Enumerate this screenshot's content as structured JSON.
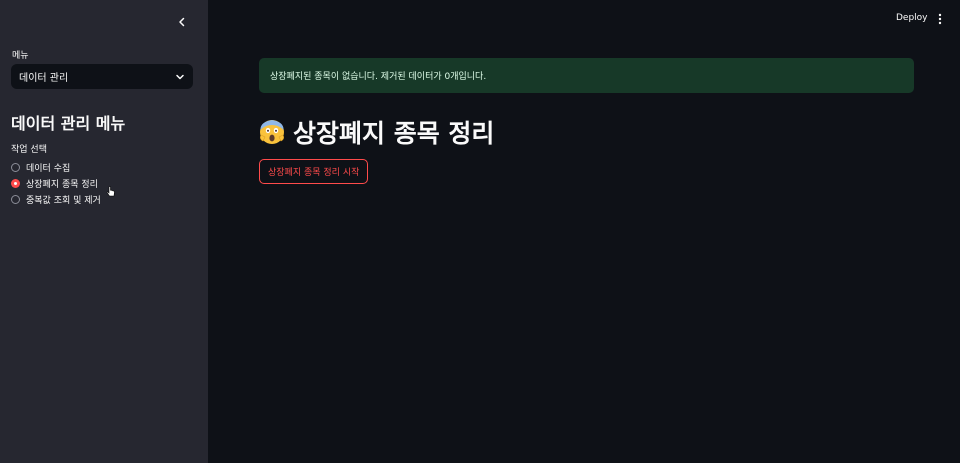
{
  "sidebar": {
    "menu_label": "메뉴",
    "menu_select_value": "데이터 관리",
    "heading": "데이터 관리 메뉴",
    "radio_label": "작업 선택",
    "radio_options": [
      {
        "label": "데이터 수집",
        "checked": false
      },
      {
        "label": "상장폐지 종목 정리",
        "checked": true
      },
      {
        "label": "중복값 조회 및 제거",
        "checked": false
      }
    ]
  },
  "header": {
    "deploy_label": "Deploy"
  },
  "main": {
    "alert_text": "상장폐지된 종목이 없습니다. 제거된 데이터가 0개입니다.",
    "title": "상장폐지 종목 정리",
    "title_emoji": "scream-emoji",
    "button_label": "상장폐지 종목 정리 시작"
  },
  "colors": {
    "sidebar_bg": "#262730",
    "main_bg": "#0e1117",
    "accent": "#ff4b4b",
    "success_bg": "#173928",
    "success_text": "#dffde9"
  }
}
